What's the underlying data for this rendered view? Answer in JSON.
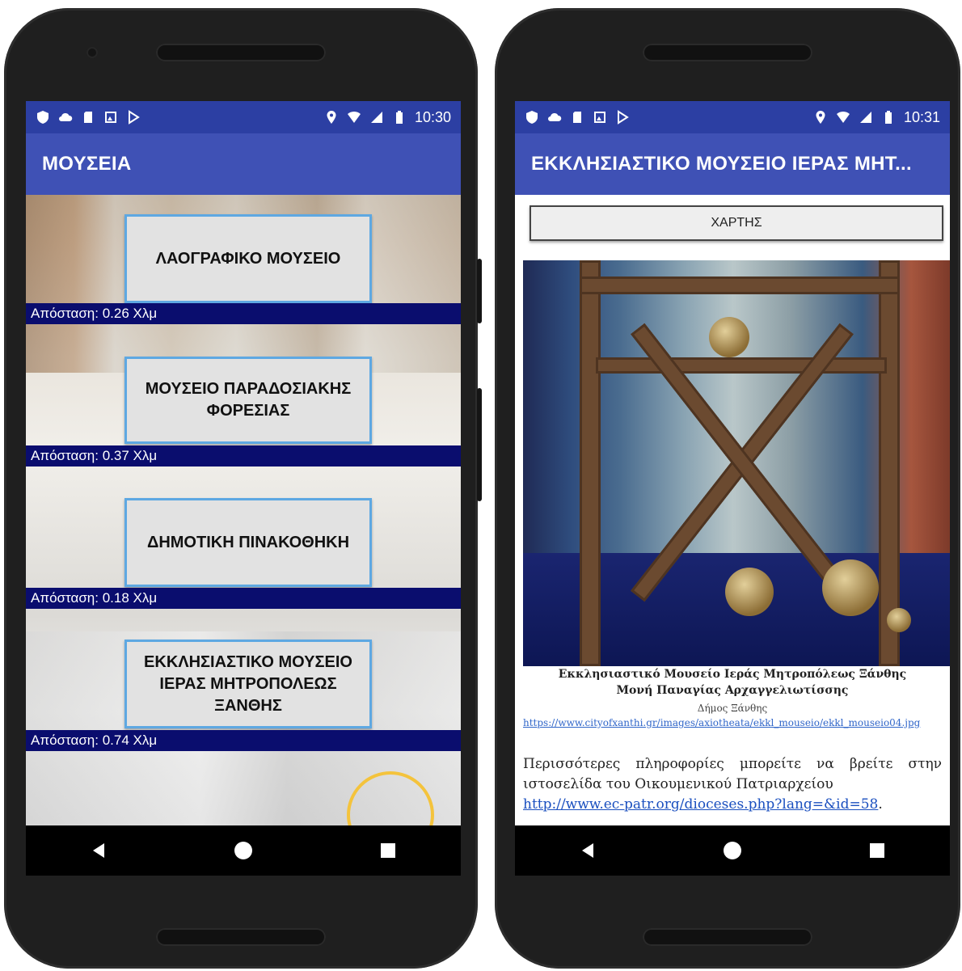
{
  "left_screen": {
    "status": {
      "time": "10:30"
    },
    "app_title": "ΜΟΥΣΕΙΑ",
    "museums": [
      {
        "name": "ΛΑΟΓΡΑΦΙΚΟ ΜΟΥΣΕΙΟ",
        "distance": "Απόσταση: 0.26 Χλμ"
      },
      {
        "name": "ΜΟΥΣΕΙΟ ΠΑΡΑΔΟΣΙΑΚΗΣ ΦΟΡΕΣΙΑΣ",
        "distance": "Απόσταση: 0.37 Χλμ"
      },
      {
        "name": "ΔΗΜΟΤΙΚΗ ΠΙΝΑΚΟΘΗΚΗ",
        "distance": "Απόσταση: 0.18 Χλμ"
      },
      {
        "name": "ΕΚΚΛΗΣΙΑΣΤΙΚΟ ΜΟΥΣΕΙΟ ΙΕΡΑΣ ΜΗΤΡΟΠΟΛΕΩΣ ΞΑΝΘΗΣ",
        "distance": "Απόσταση: 0.74 Χλμ"
      }
    ]
  },
  "right_screen": {
    "status": {
      "time": "10:31"
    },
    "app_title": "ΕΚΚΛΗΣΙΑΣΤΙΚΟ ΜΟΥΣΕΙΟ ΙΕΡΑΣ ΜΗΤ...",
    "map_button": "ΧΑΡΤΗΣ",
    "caption_line1": "Εκκλησιαστικό Μουσείο Ιεράς Μητροπόλεως Ξάνθης",
    "caption_line2": "Μονή Παναγίας Αρχαγγελιωτίσσης",
    "caption_credit": "Δήμος Ξάνθης",
    "caption_url": "https://www.cityofxanthi.gr/images/axiotheata/ekkl_mouseio/ekkl_mouseio04.jpg",
    "info_text": "Περισσότερες πληροφορίες μπορείτε να βρείτε στην ιστοσελίδα του Οικουμενικού Πατριαρχείου",
    "info_link": "http://www.ec-patr.org/dioceses.php?lang=&id=58"
  }
}
